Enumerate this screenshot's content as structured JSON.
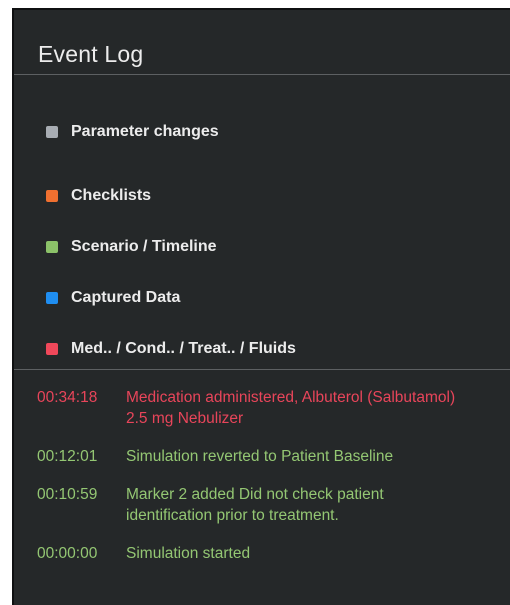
{
  "panel": {
    "title": "Event Log"
  },
  "legend": [
    {
      "label": "Parameter changes",
      "color": "#a8adb3"
    },
    {
      "label": "Checklists",
      "color": "#f07030"
    },
    {
      "label": "Scenario / Timeline",
      "color": "#8cc269"
    },
    {
      "label": "Captured Data",
      "color": "#1f8ef1"
    },
    {
      "label": "Med.. / Cond.. / Treat.. / Fluids",
      "color": "#f0485a"
    }
  ],
  "log": [
    {
      "time": "00:34:18",
      "message": "Medication administered, Albuterol (Salbutamol) 2.5 mg Nebulizer",
      "category": "Med.. / Cond.. / Treat.. / Fluids",
      "color": "#e8455a"
    },
    {
      "time": "00:12:01",
      "message": "Simulation reverted to Patient Baseline",
      "category": "Scenario / Timeline",
      "color": "#94c773"
    },
    {
      "time": "00:10:59",
      "message": "Marker 2 added Did not check patient identification prior to treatment.",
      "category": "Scenario / Timeline",
      "color": "#94c773"
    },
    {
      "time": "00:00:00",
      "message": "Simulation started",
      "category": "Scenario / Timeline",
      "color": "#94c773"
    }
  ]
}
